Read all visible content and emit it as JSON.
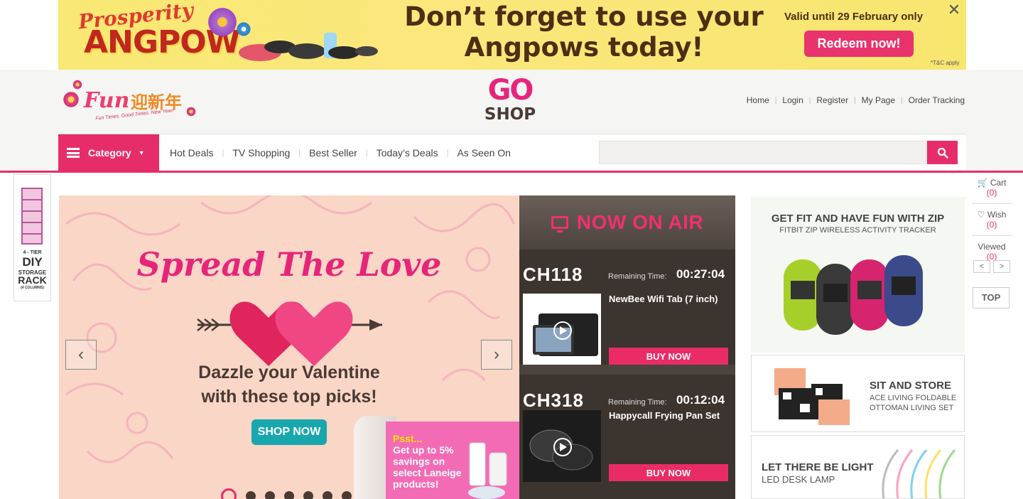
{
  "promo_banner": {
    "brand_top": "Prosperity",
    "brand_bottom": "ANGPOW",
    "headline_line1": "Don’t forget to use your",
    "headline_line2": "Angpows today!",
    "valid_text": "Valid until 29 February only",
    "redeem_label": "Redeem now!",
    "tnc": "*T&C apply",
    "close_label": "✕",
    "colors": {
      "background": "#f9e873",
      "redeem": "#e9336d",
      "text": "#4c2f14"
    }
  },
  "header": {
    "fun_logo_text": "Fun",
    "fun_logo_chinese": "迎新年",
    "fun_logo_tagline": "Fun Times. Good Times. New Year!",
    "goshop_go": "GO",
    "goshop_shop": "SHOP",
    "top_links": [
      "Home",
      "Login",
      "Register",
      "My Page",
      "Order Tracking"
    ]
  },
  "nav": {
    "category_label": "Category",
    "links": [
      "Hot Deals",
      "TV Shopping",
      "Best Seller",
      "Today’s Deals",
      "As Seen On"
    ],
    "search_placeholder": "",
    "accent_color": "#e62d69"
  },
  "side_ad": {
    "line1": "4 - TIER",
    "line2": "DIY",
    "line3": "STORAGE",
    "line4": "RACK",
    "line5": "(4 COLUMNS)"
  },
  "hero": {
    "title": "Spread The Love",
    "subtitle_line1": "Dazzle your Valentine",
    "subtitle_line2": "with these top picks!",
    "cta": "SHOP NOW",
    "promo_psst": "Psst...",
    "promo_text": "Get up to 5% savings on select Laneige products!",
    "prev_label": "‹",
    "next_label": "›",
    "slide_count": 7,
    "active_slide": 1
  },
  "on_air": {
    "title": "NOW ON AIR",
    "remaining_label": "Remaining Time:",
    "buy_label": "BUY NOW",
    "channels": [
      {
        "channel": "CH118",
        "time": "00:27:04",
        "product": "NewBee Wifi Tab (7 inch)"
      },
      {
        "channel": "CH318",
        "time": "00:12:04",
        "product": "Happycall Frying Pan Set"
      }
    ]
  },
  "right_promos": [
    {
      "heading": "GET FIT AND HAVE FUN WITH ZIP",
      "sub": "FITBIT ZIP WIRELESS ACTIVITY TRACKER"
    },
    {
      "heading": "SIT AND STORE",
      "sub": "ACE LIVING FOLDABLE OTTOMAN LIVING SET"
    },
    {
      "heading": "LET THERE BE LIGHT",
      "sub": "LED DESK LAMP"
    }
  ],
  "right_sidebar": {
    "cart_label": "Cart",
    "cart_count": "(0)",
    "wish_label": "Wish",
    "wish_count": "(0)",
    "viewed_label": "Viewed",
    "viewed_count": "(0)",
    "prev_label": "<",
    "next_label": ">",
    "top_label": "TOP"
  }
}
